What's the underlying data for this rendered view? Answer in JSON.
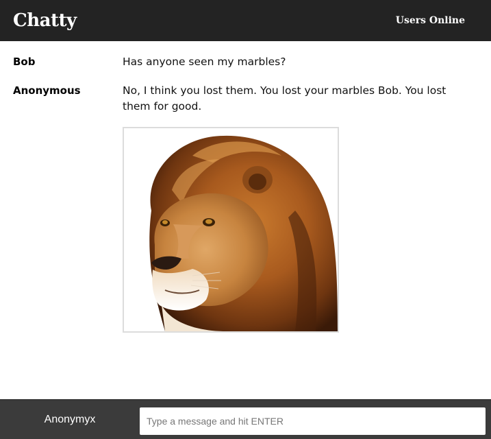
{
  "navbar": {
    "brand": "Chatty",
    "users_online": "Users Online"
  },
  "messages": [
    {
      "username": "Bob",
      "content": "Has anyone seen my marbles?"
    },
    {
      "username": "Anonymous",
      "content": "No, I think you lost them. You lost your marbles Bob. You lost them for good."
    }
  ],
  "image_message": {
    "description_icon": "lion-image"
  },
  "chatbar": {
    "username": "Anonymyx",
    "message_placeholder": "Type a message and hit ENTER",
    "message_value": ""
  }
}
